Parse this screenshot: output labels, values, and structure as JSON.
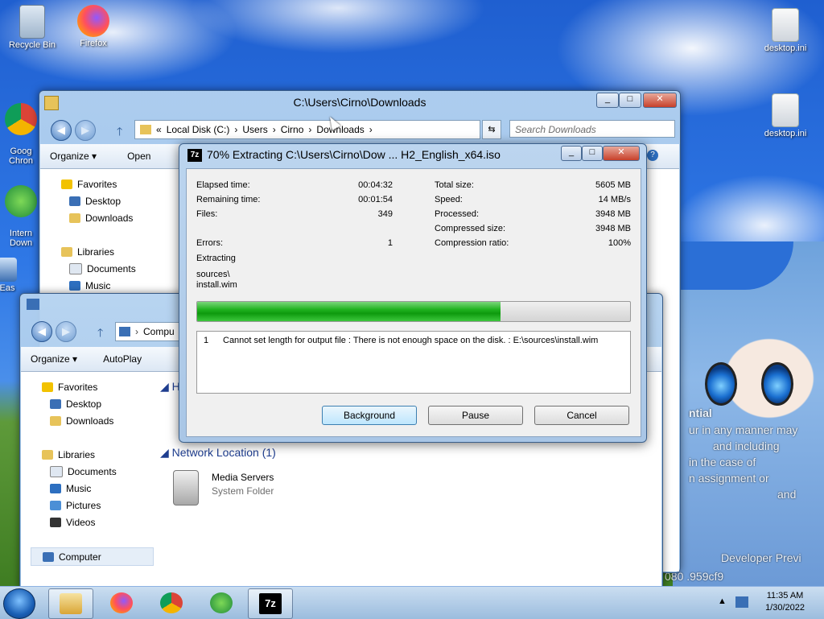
{
  "desktop": {
    "icons": [
      {
        "label": "Recycle Bin"
      },
      {
        "label": "Firefox"
      },
      {
        "label": "Goog\nChron"
      },
      {
        "label": "Intern\nDown"
      },
      {
        "label": "Eas"
      },
      {
        "label": "desktop.ini"
      },
      {
        "label": "desktop.ini"
      }
    ],
    "wallpaper_text": [
      "ntial",
      "ur in any manner may",
      "and including",
      "in the case of",
      "n assignment or",
      "and",
      "Developer Previ",
      "080 .959cf9"
    ]
  },
  "explorer_back": {
    "title": "C:\\Users\\Cirno\\Downloads",
    "address": [
      "«",
      "Local Disk (C:)",
      "›",
      "Users",
      "›",
      "Cirno",
      "›",
      "Downloads",
      "›"
    ],
    "search_placeholder": "Search Downloads",
    "toolbar": {
      "organize": "Organize ▾",
      "open": "Open"
    },
    "nav": {
      "favorites": "Favorites",
      "desktop": "Desktop",
      "downloads": "Downloads",
      "libraries": "Libraries",
      "documents": "Documents",
      "music": "Music"
    }
  },
  "explorer_front": {
    "address": "Compu",
    "toolbar": {
      "organize": "Organize ▾",
      "autoplay": "AutoPlay"
    },
    "nav": {
      "favorites": "Favorites",
      "desktop": "Desktop",
      "downloads": "Downloads",
      "libraries": "Libraries",
      "documents": "Documents",
      "music": "Music",
      "pictures": "Pictures",
      "videos": "Videos",
      "computer": "Computer"
    },
    "group_header_cut": "H",
    "group_network": "Network Location (1)",
    "item": {
      "name": "Media Servers",
      "type": "System Folder"
    }
  },
  "dialog": {
    "title": "70% Extracting C:\\Users\\Cirno\\Dow ... H2_English_x64.iso",
    "left": [
      {
        "label": "Elapsed time:",
        "value": "00:04:32"
      },
      {
        "label": "Remaining time:",
        "value": "00:01:54"
      },
      {
        "label": "Files:",
        "value": "349"
      },
      {
        "label": "Errors:",
        "value": "1"
      }
    ],
    "right": [
      {
        "label": "Total size:",
        "value": "5605 MB"
      },
      {
        "label": "Speed:",
        "value": "14 MB/s"
      },
      {
        "label": "Processed:",
        "value": "3948 MB"
      },
      {
        "label": "Compressed size:",
        "value": "3948 MB"
      },
      {
        "label": "Compression ratio:",
        "value": "100%"
      }
    ],
    "status": "Extracting",
    "current_path": "sources\\",
    "current_file": "install.wim",
    "progress": 0.7,
    "log_index": "1",
    "log_message": "Cannot set length for output file : There is not enough space on the disk. : E:\\sources\\install.wim",
    "buttons": {
      "background": "Background",
      "pause": "Pause",
      "cancel": "Cancel"
    }
  },
  "taskbar": {
    "time": "11:35 AM",
    "date": "1/30/2022"
  }
}
